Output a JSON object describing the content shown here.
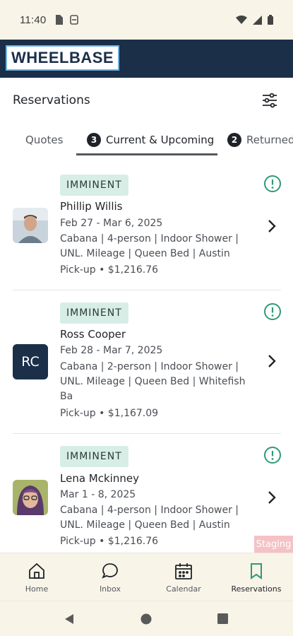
{
  "status_bar": {
    "time": "11:40",
    "icons": [
      "sd-card-icon",
      "sync-icon",
      "wifi-icon",
      "signal-icon",
      "battery-icon"
    ]
  },
  "header": {
    "logo_text": "WHEELBASE"
  },
  "page": {
    "title": "Reservations",
    "filter_icon": "sliders-icon"
  },
  "tabs": [
    {
      "label": "Quotes",
      "count": ""
    },
    {
      "label": "Current & Upcoming",
      "count": "3",
      "active": true
    },
    {
      "label": "Returned",
      "count": "2"
    }
  ],
  "reservations": [
    {
      "status": "IMMINENT",
      "name": "Phillip Willis",
      "dates": "Feb 27 - Mar 6, 2025",
      "details_line1": "Cabana | 4-person | Indoor Shower |",
      "details_line2": "UNL. Mileage | Queen Bed | Austin",
      "details_line3": "",
      "pickup": "Pick-up  •  $1,216.76",
      "avatar": "photo"
    },
    {
      "status": "IMMINENT",
      "name": "Ross Cooper",
      "dates": "Feb 28 - Mar 7, 2025",
      "details_line1": "Cabana | 2-person | Indoor Shower |",
      "details_line2": "UNL. Mileage | Queen Bed | Whitefish",
      "details_line3": "Ba",
      "pickup": "Pick-up  •  $1,167.09",
      "avatar_initials": "RC"
    },
    {
      "status": "IMMINENT",
      "name": "Lena Mckinney",
      "dates": "Mar 1 - 8, 2025",
      "details_line1": "Cabana | 4-person | Indoor Shower |",
      "details_line2": "UNL. Mileage | Queen Bed | Austin",
      "details_line3": "",
      "pickup": "Pick-up  •  $1,216.76",
      "avatar": "photo"
    }
  ],
  "staging_label": "Staging",
  "bottom_nav": [
    {
      "label": "Home",
      "icon": "home-icon"
    },
    {
      "label": "Inbox",
      "icon": "chat-icon"
    },
    {
      "label": "Calendar",
      "icon": "calendar-icon"
    },
    {
      "label": "Reservations",
      "icon": "bookmark-icon",
      "active": true
    }
  ],
  "colors": {
    "brand_navy": "#1b2f49",
    "accent_green": "#2e9b78",
    "badge_bg": "#d7eee7",
    "cream": "#f8f4e8"
  }
}
